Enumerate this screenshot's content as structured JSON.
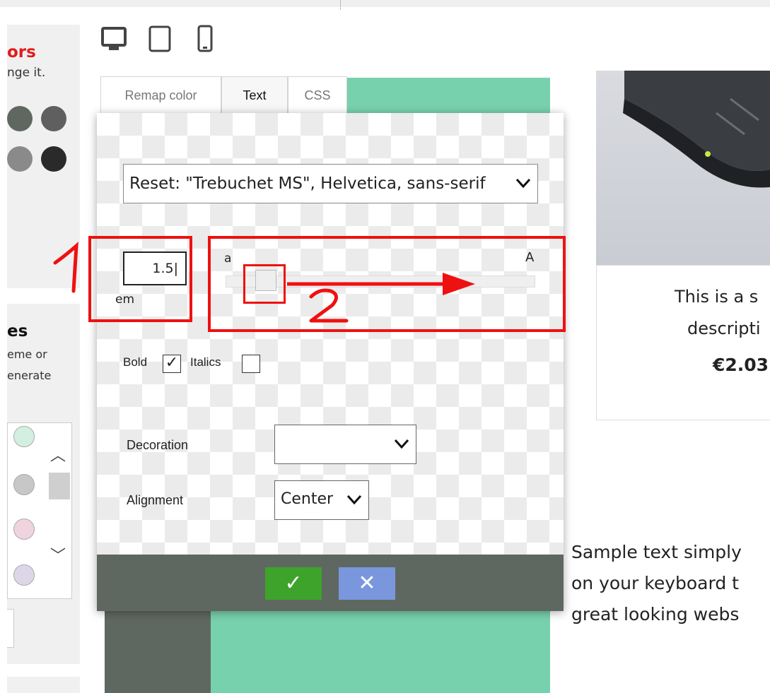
{
  "left_panel": {
    "title": "ors",
    "subtitle": "nge it.",
    "swatches": [
      "#5f6860",
      "#5f5f5f",
      "#8a8a8a",
      "#2a2a2a"
    ]
  },
  "left_panel2": {
    "title": "es",
    "line1": "eme or",
    "line2": "enerate",
    "list_colors": [
      "#d3efe2",
      "#c7c7c7",
      "#efd3de",
      "#ddd5e8"
    ]
  },
  "dialog": {
    "tabs": [
      "Remap color",
      "Text",
      "CSS"
    ],
    "active_tab": "Text",
    "font_select": "Reset: \"Trebuchet MS\", Helvetica, sans-serif",
    "size_value": "1.5",
    "size_unit": "em",
    "slider_min_label": "a",
    "slider_max_label": "A",
    "bold_label": "Bold",
    "bold_checked": true,
    "italics_label": "Italics",
    "italics_checked": false,
    "decoration_label": "Decoration",
    "decoration_value": "",
    "alignment_label": "Alignment",
    "alignment_value": "Center",
    "ok_icon": "✓",
    "cancel_icon": "✕"
  },
  "preview": {
    "desc_line1": "This is a s",
    "desc_line2": "descripti",
    "price": "€2.03",
    "sample_lines": [
      "Sample text simply",
      "on your keyboard t",
      "great looking webs"
    ]
  },
  "annotations": {
    "label1": "1",
    "label2": "2",
    "color": "#ee1111"
  }
}
